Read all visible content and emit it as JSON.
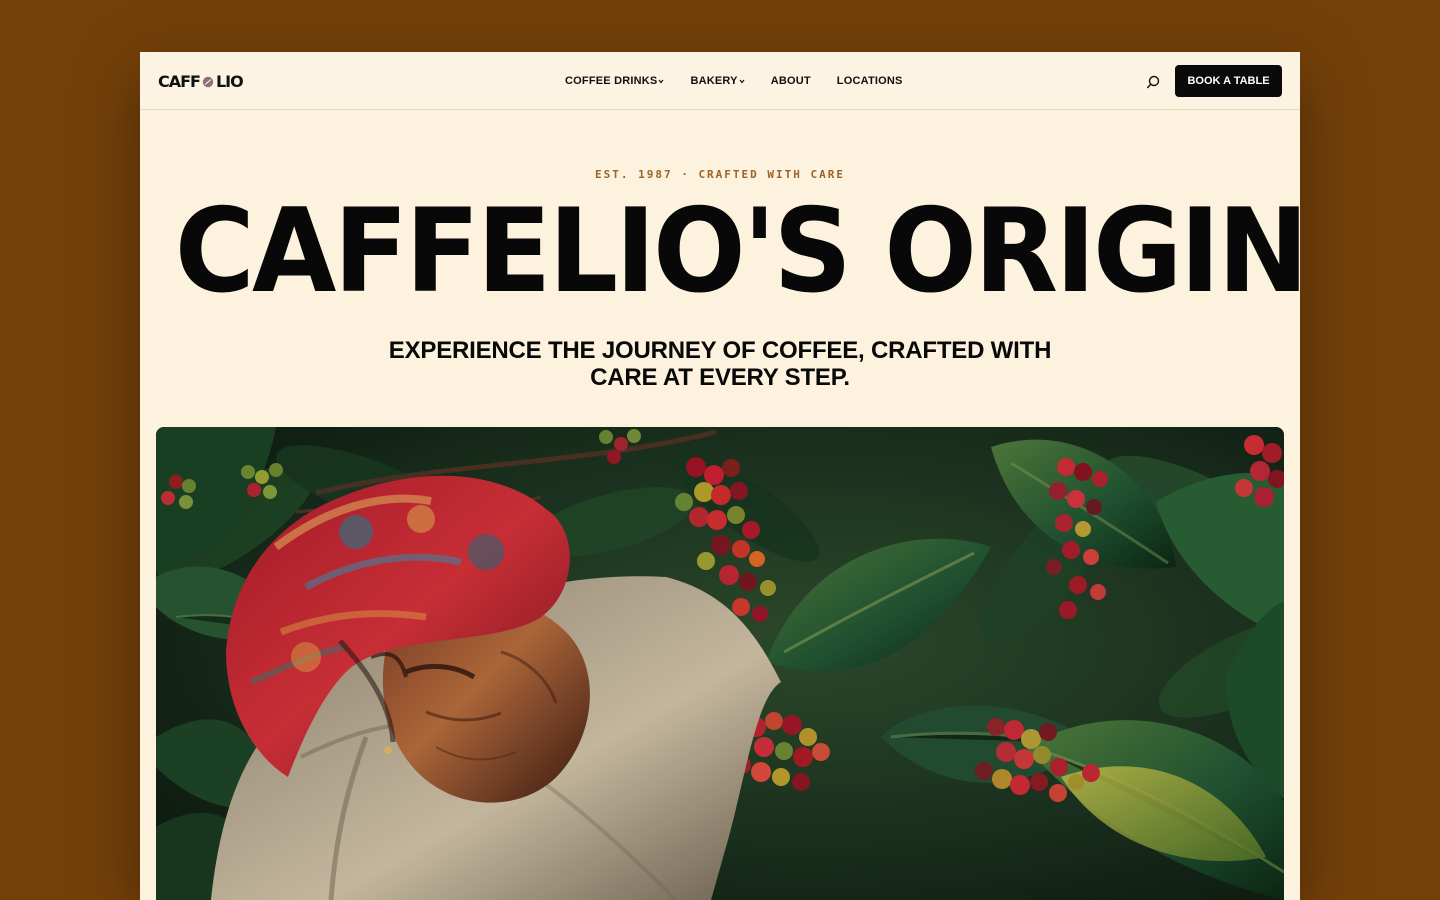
{
  "window": {
    "title": "CAFFELIO"
  },
  "header": {
    "logo": {
      "prefix": "CAFF",
      "suffix": "LIO",
      "icon": "coffee-bean-icon"
    },
    "nav": [
      {
        "label": "COFFEE DRINKS",
        "icon": "chevron-down-icon"
      },
      {
        "label": "BAKERY",
        "icon": "chevron-down-icon"
      },
      {
        "label": "ABOUT"
      },
      {
        "label": "LOCATIONS"
      }
    ],
    "search_icon": "search-icon",
    "book_label": "BOOK A TABLE"
  },
  "hero": {
    "eyebrow": "EST. 1987 · CRAFTED WITH CARE",
    "title": "CAFFELIO'S ORIGIN",
    "subtitle": "EXPERIENCE THE JOURNEY OF COFFEE, CRAFTED WITH CARE AT EVERY STEP.",
    "image": "coffee-harvest-image"
  },
  "colors": {
    "background": "#74400a",
    "page": "#fcf2de",
    "accent": "#9a6428",
    "button": "#0a0a0a"
  }
}
